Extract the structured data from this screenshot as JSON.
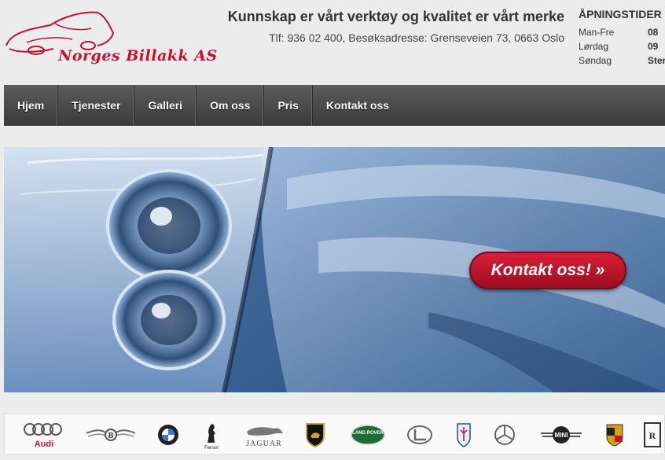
{
  "header": {
    "logo_text": "Norges Billakk AS",
    "tagline": "Kunnskap er vårt verktøy og kvalitet er vårt merke",
    "contact": "Tlf: 936 02 400, Besøksadresse: Grenseveien 73, 0663 Oslo"
  },
  "hours": {
    "title": "ÅPNINGSTIDER",
    "rows": [
      {
        "day": "Man-Fre",
        "time": "08"
      },
      {
        "day": "Lørdag",
        "time": "09"
      },
      {
        "day": "Søndag",
        "time": "Ster"
      }
    ]
  },
  "nav": {
    "items": [
      "Hjem",
      "Tjenester",
      "Galleri",
      "Om oss",
      "Pris",
      "Kontakt oss"
    ]
  },
  "hero": {
    "cta_label": "Kontakt oss! »"
  },
  "brands": {
    "audi_text": "Audi",
    "jaguar_text": "JAGUAR",
    "landrover_text": "LAND ROVER",
    "mini_text": "MINI",
    "ferrari_text": "Ferrari",
    "items": [
      "audi-logo",
      "bentley-logo",
      "bmw-logo",
      "ferrari-logo",
      "jaguar-logo",
      "lamborghini-logo",
      "land-rover-logo",
      "lexus-logo",
      "maserati-logo",
      "mercedes-logo",
      "mini-logo",
      "porsche-logo",
      "rolls-royce-logo"
    ]
  },
  "colors": {
    "brand_red": "#c8102e",
    "nav_bg": "#444444",
    "cta_red": "#c0142e"
  }
}
